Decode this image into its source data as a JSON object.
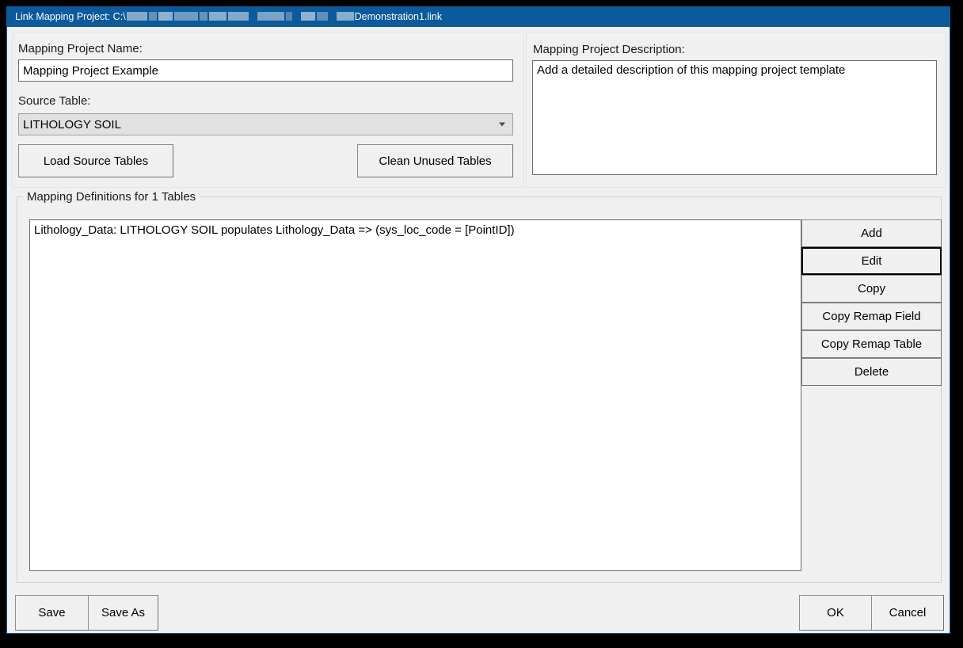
{
  "window": {
    "title_prefix": "Link Mapping Project: C:\\",
    "title_suffix": "Demonstration1.link",
    "title_full": "Link Mapping Project: C:\\[redacted path]\\Demonstration1.link",
    "titlebar_color": "#0a5a9c",
    "titlebar_text_color": "#ffffff",
    "background_color": "#f0f0f0"
  },
  "left_panel": {
    "project_name_label": "Mapping Project Name:",
    "project_name_value": "Mapping Project Example",
    "source_table_label": "Source Table:",
    "source_table_value": "LITHOLOGY SOIL",
    "source_table_options": [
      "LITHOLOGY SOIL"
    ],
    "load_source_tables_button": "Load Source Tables",
    "clean_unused_tables_button": "Clean Unused Tables"
  },
  "right_panel": {
    "description_label": "Mapping Project Description:",
    "description_value": "Add a detailed description of this mapping project template"
  },
  "group": {
    "title": "Mapping Definitions for 1 Tables",
    "definitions": [
      "Lithology_Data: LITHOLOGY SOIL populates Lithology_Data => (sys_loc_code = [PointID])"
    ],
    "buttons": [
      {
        "label": "Add",
        "focused": false
      },
      {
        "label": "Edit",
        "focused": true
      },
      {
        "label": "Copy",
        "focused": false
      },
      {
        "label": "Copy Remap Field",
        "focused": false
      },
      {
        "label": "Copy Remap Table",
        "focused": false
      },
      {
        "label": "Delete",
        "focused": false
      }
    ]
  },
  "footer": {
    "save_label": "Save",
    "save_as_label": "Save As",
    "ok_label": "OK",
    "cancel_label": "Cancel"
  }
}
